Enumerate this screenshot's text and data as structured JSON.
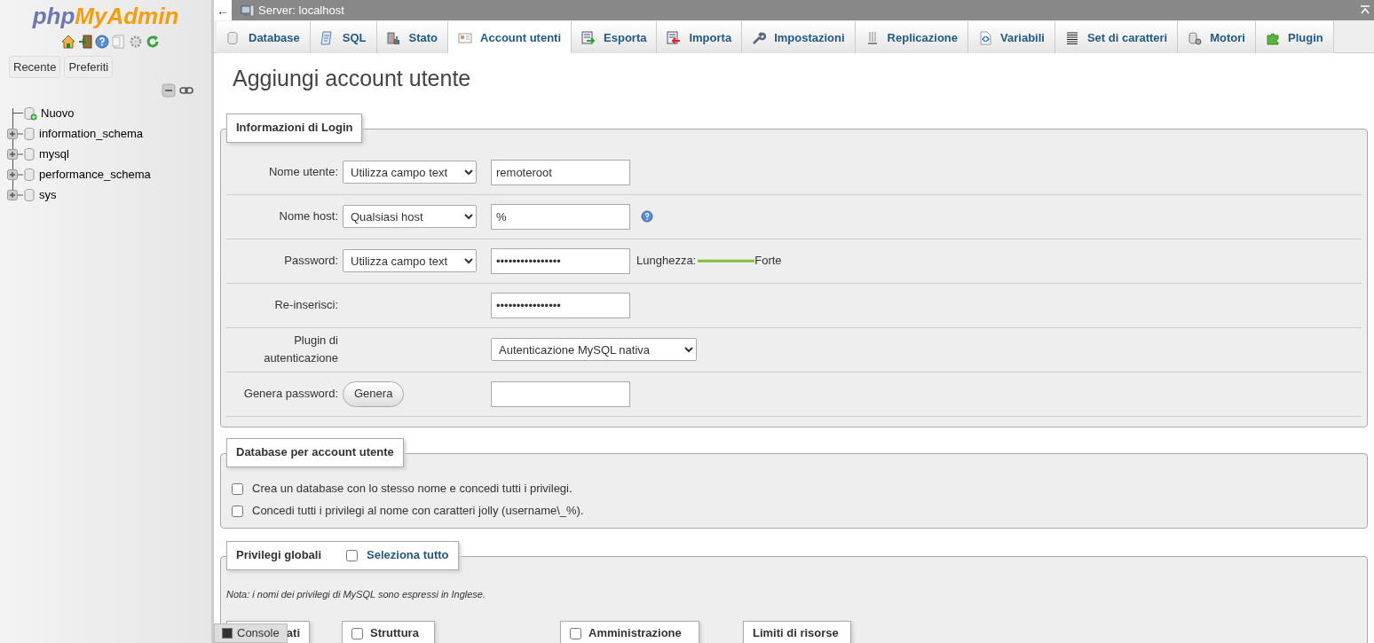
{
  "sidebar": {
    "logo_php": "php",
    "logo_rest": "MyAdmin",
    "buttons": [
      "Recente",
      "Preferiti"
    ],
    "tree": [
      {
        "label": "Nuovo",
        "kind": "new"
      },
      {
        "label": "information_schema",
        "kind": "database"
      },
      {
        "label": "mysql",
        "kind": "database"
      },
      {
        "label": "performance_schema",
        "kind": "database"
      },
      {
        "label": "sys",
        "kind": "database"
      }
    ]
  },
  "topbar": {
    "back": "←",
    "title": "Server: localhost"
  },
  "tabs": [
    {
      "label": "Database",
      "selected": false
    },
    {
      "label": "SQL",
      "selected": false
    },
    {
      "label": "Stato",
      "selected": false
    },
    {
      "label": "Account utenti",
      "selected": true
    },
    {
      "label": "Esporta",
      "selected": false
    },
    {
      "label": "Importa",
      "selected": false
    },
    {
      "label": "Impostazioni",
      "selected": false
    },
    {
      "label": "Replicazione",
      "selected": false
    },
    {
      "label": "Variabili",
      "selected": false
    },
    {
      "label": "Set di caratteri",
      "selected": false
    },
    {
      "label": "Motori",
      "selected": false
    },
    {
      "label": "Plugin",
      "selected": false
    }
  ],
  "page_title": "Aggiungi account utente",
  "login": {
    "legend": "Informazioni di Login",
    "rows": [
      {
        "label": "Nome utente:",
        "select": "Utilizza campo text",
        "value": "remoteroot"
      },
      {
        "label": "Nome host:",
        "select": "Qualsiasi host",
        "value": "%",
        "help": true
      },
      {
        "label": "Password:",
        "select": "Utilizza campo text",
        "value": "••••••••••••••••",
        "strength": {
          "label": "Lunghezza:",
          "level": 1,
          "text": "Forte"
        }
      },
      {
        "label": "Re-inserisci:",
        "value": "••••••••••••••••"
      },
      {
        "label": "Plugin di autenticazione",
        "wide_select": "Autenticazione MySQL nativa"
      },
      {
        "label": "Genera password:",
        "button": "Genera",
        "value": ""
      }
    ]
  },
  "database_section": {
    "legend": "Database per account utente",
    "options": [
      {
        "label": "Crea un database con lo stesso nome e concedi tutti i privilegi.",
        "checked": false
      },
      {
        "label": "Concedi tutti i privilegi al nome con caratteri jolly (username\\_%).",
        "checked": false
      }
    ]
  },
  "global_privileges": {
    "legend": "Privilegi globali",
    "select_all": {
      "label": "Seleziona tutto",
      "checked": false
    },
    "note": "Nota: i nomi dei privilegi di MySQL sono espressi in Inglese.",
    "groups": [
      {
        "label": "ati"
      },
      {
        "label": "Struttura",
        "checked": false
      },
      {
        "label": "Amministrazione",
        "checked": false
      },
      {
        "label": "Limiti di risorse"
      }
    ]
  },
  "console": {
    "label": "Console"
  }
}
